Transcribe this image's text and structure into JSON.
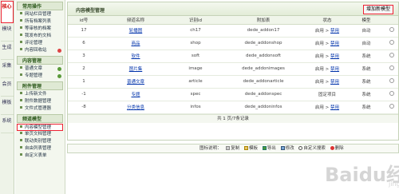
{
  "tabs": [
    "核心",
    "模块",
    "生成",
    "采集",
    "会员",
    "模板",
    "系统"
  ],
  "menu": {
    "section1": {
      "title": "常用操作",
      "items": [
        "网站栏目管理",
        "所有档案列表",
        "等审核的档案",
        "我发布的文档",
        "评论管理",
        "内容回收站"
      ]
    },
    "section2": {
      "title": "内容管理",
      "items": [
        "普通文章",
        "专题管理"
      ]
    },
    "section3": {
      "title": "附件管理",
      "items": [
        "上传新文件",
        "附件数据管理",
        "文件式管理器"
      ]
    },
    "section4": {
      "title": "频道模型",
      "items": [
        "内容模型管理",
        "单页文档管理",
        "联动类别管理",
        "自由列表管理",
        "自定义表单"
      ]
    }
  },
  "panel": {
    "title": "内容模型管理",
    "add_button": "增加新模型"
  },
  "table": {
    "headers": [
      "id号",
      "频道名称",
      "识别id",
      "附加表",
      "状态",
      "模型",
      ""
    ],
    "rows": [
      {
        "id": "17",
        "name": "轮播图",
        "nid": "ch17",
        "table": "dede_addon17",
        "status": "启用",
        "action": "禁用",
        "model": "自动"
      },
      {
        "id": "6",
        "name": "商品",
        "nid": "shop",
        "table": "dede_addonshop",
        "status": "启用",
        "action": "禁用",
        "model": "自动"
      },
      {
        "id": "3",
        "name": "软件",
        "nid": "soft",
        "table": "dede_addonsoft",
        "status": "启用",
        "action": "禁用",
        "model": "系统"
      },
      {
        "id": "2",
        "name": "图片集",
        "nid": "image",
        "table": "dede_addonimages",
        "status": "启用",
        "action": "禁用",
        "model": "系统"
      },
      {
        "id": "1",
        "name": "普通文章",
        "nid": "article",
        "table": "dede_addonarticle",
        "status": "启用",
        "action": "禁用",
        "model": "系统"
      },
      {
        "id": "-1",
        "name": "专题",
        "nid": "spec",
        "table": "dede_addonspec",
        "status": "固定项目",
        "action": "",
        "model": "系统"
      },
      {
        "id": "-8",
        "name": "分类信息",
        "nid": "infos",
        "table": "dede_addoninfos",
        "status": "启用",
        "action": "禁用",
        "model": "系统"
      }
    ],
    "status_sep": " > "
  },
  "pager": "共 1 页/7条记录",
  "legend": {
    "label": "图标说明：",
    "items": [
      "复制",
      "模板",
      "导出",
      "修改",
      "自定义搜索",
      "删除"
    ]
  },
  "watermark": {
    "line1": "Baidu经验",
    "line2": "jingyan.baidu.com"
  }
}
